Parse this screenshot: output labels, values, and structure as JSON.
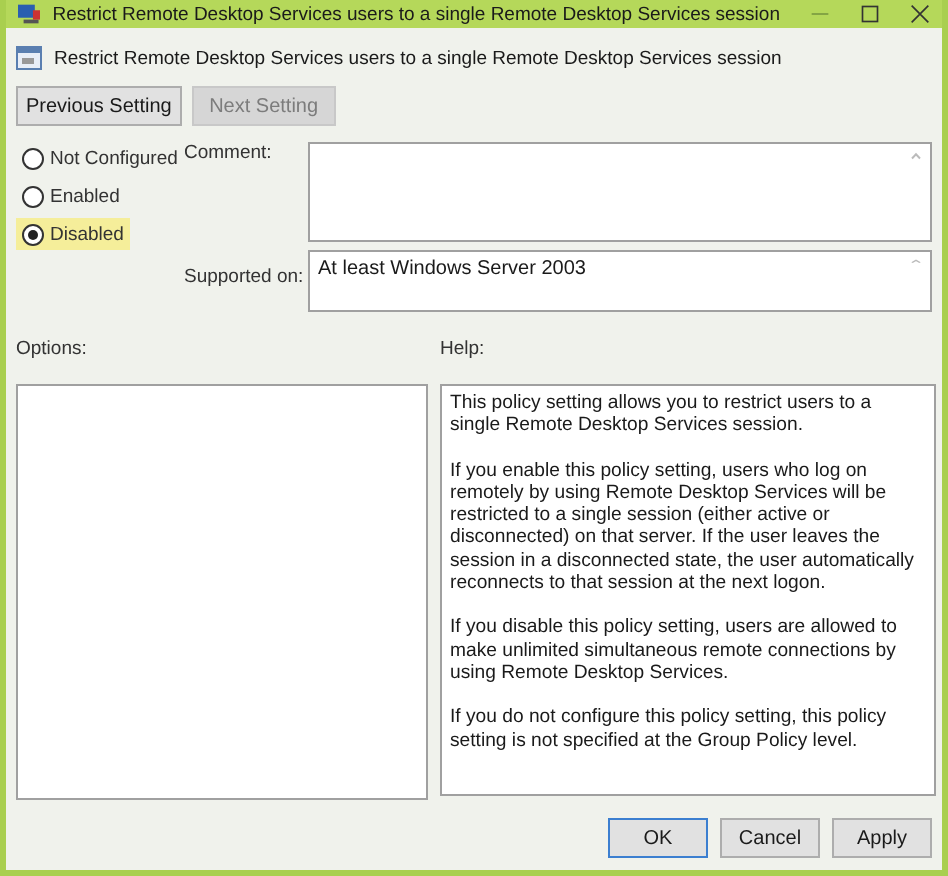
{
  "window": {
    "title": "Restrict Remote Desktop Services users to a single Remote Desktop Services session"
  },
  "header": {
    "title": "Restrict Remote Desktop Services users to a single Remote Desktop Services session"
  },
  "nav_buttons": [
    {
      "label": "Previous Setting",
      "disabled": false
    },
    {
      "label": "Next Setting",
      "disabled": true
    }
  ],
  "state_options": [
    {
      "label": "Not Configured",
      "selected": false,
      "highlighted": false
    },
    {
      "label": "Enabled",
      "selected": false,
      "highlighted": false
    },
    {
      "label": "Disabled",
      "selected": true,
      "highlighted": true
    }
  ],
  "comment": {
    "label": "Comment:"
  },
  "supported_on": {
    "label": "Supported on:",
    "value": "At least Windows Server 2003"
  },
  "options": {
    "label": "Options:"
  },
  "help": {
    "label": "Help:",
    "paragraphs": [
      "This policy setting allows you to restrict users to a single Remote Desktop Services session.",
      "If you enable this policy setting, users who log on remotely by using Remote Desktop Services will be restricted to a single session (either active or disconnected) on that server. If the user leaves the session in a disconnected state, the user automatically reconnects to that session at the next logon.",
      "If you disable this policy setting, users are allowed to make unlimited simultaneous remote connections by using Remote Desktop Services.",
      "If you do not configure this policy setting,  this policy setting is not specified at the Group Policy level."
    ]
  },
  "footer_buttons": [
    {
      "label": "OK",
      "default": true
    },
    {
      "label": "Cancel",
      "default": false
    },
    {
      "label": "Apply",
      "default": false
    }
  ]
}
